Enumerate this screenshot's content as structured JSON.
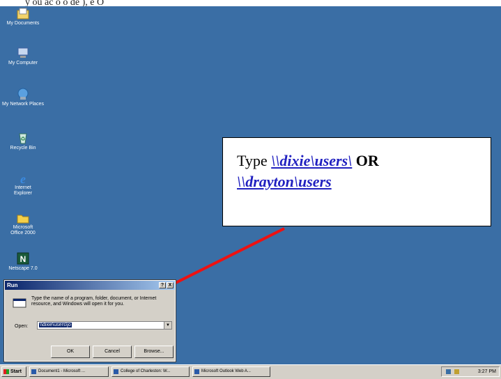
{
  "caption_fragment": "y  ou  ac  o  o  de  ),  e  O",
  "desktop": {
    "icons": [
      {
        "label": "My Documents",
        "icon": "my-documents-icon"
      },
      {
        "label": "My Computer",
        "icon": "my-computer-icon"
      },
      {
        "label": "My Network Places",
        "icon": "network-places-icon"
      },
      {
        "label": "Recycle Bin",
        "icon": "recycle-bin-icon"
      },
      {
        "label": "Internet Explorer",
        "icon": "internet-explorer-icon"
      },
      {
        "label": "Microsoft Office 2000",
        "icon": "folder-icon"
      },
      {
        "label": "Netscape 7.0",
        "icon": "netscape-icon"
      }
    ]
  },
  "callout": {
    "type_word": "Type",
    "path1": "\\\\dixie\\users\\",
    "or_word": "OR",
    "path2": "\\\\drayton\\users"
  },
  "run_dialog": {
    "title": "Run",
    "help_btn": "?",
    "close_btn": "X",
    "description": "Type the name of a program, folder, document, or Internet resource, and Windows will open it for you.",
    "open_label": "Open:",
    "open_value": "\\\\dixie\\users\\jo",
    "ok_label": "OK",
    "cancel_label": "Cancel",
    "browse_label": "Browse..."
  },
  "taskbar": {
    "start_label": "Start",
    "tasks": [
      "Document1 - Microsoft ...",
      "College of Charleston: W...",
      "Microsoft Outlook Web A..."
    ],
    "clock": "3:27 PM"
  },
  "colors": {
    "desktop": "#3a6ea5",
    "arrow": "#ee1111",
    "link": "#2020c0"
  }
}
